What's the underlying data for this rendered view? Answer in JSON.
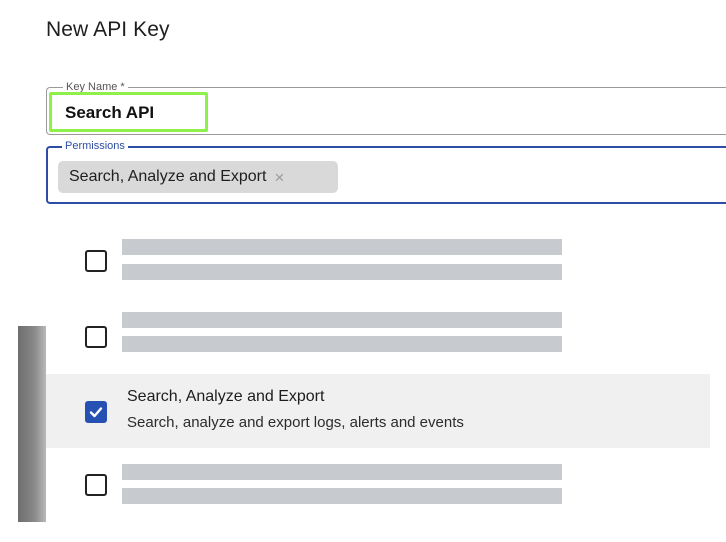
{
  "dialog": {
    "title": "New API Key"
  },
  "key_name": {
    "label": "Key Name *",
    "value": "Search API"
  },
  "permissions": {
    "label": "Permissions",
    "selected_chip": "Search, Analyze and Export",
    "chip_remove_glyph": "×"
  },
  "options": [
    {
      "state": "loading",
      "checked": false
    },
    {
      "state": "loading",
      "checked": false
    },
    {
      "state": "loaded",
      "checked": true,
      "title": "Search, Analyze and Export",
      "description": "Search, analyze and export logs, alerts and events"
    },
    {
      "state": "loading",
      "checked": false
    }
  ],
  "colors": {
    "focus_blue": "#2d4ea6",
    "checkbox_blue": "#2750b3",
    "highlight_green": "#8ef04a",
    "skeleton_gray": "#c7cbd0",
    "chip_gray": "#d9d9d9"
  }
}
